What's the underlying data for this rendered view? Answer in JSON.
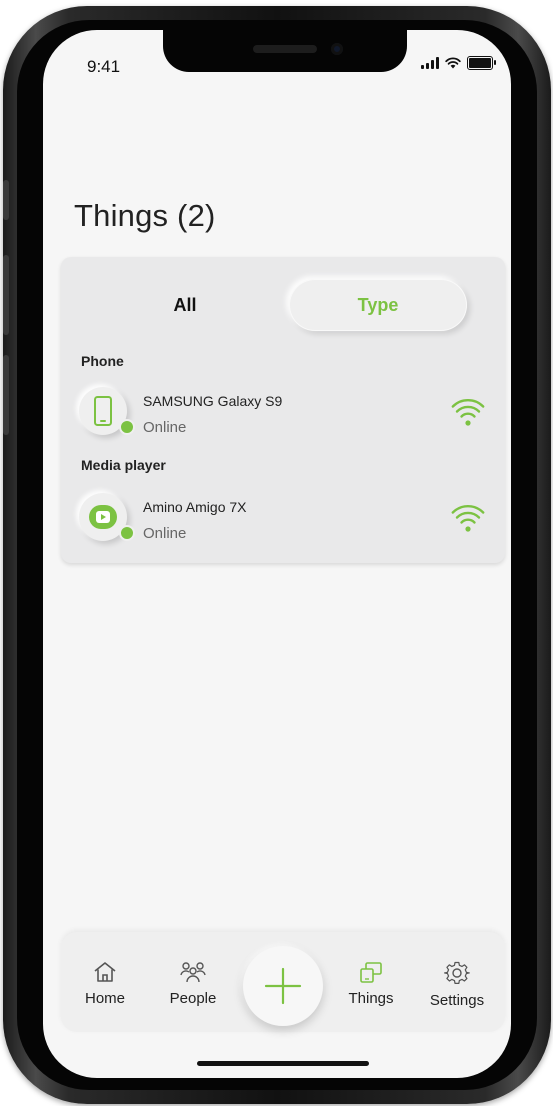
{
  "status_bar": {
    "time": "9:41"
  },
  "page": {
    "title": "Things (2)"
  },
  "tabs": [
    {
      "label": "All",
      "selected": false
    },
    {
      "label": "Type",
      "selected": true
    }
  ],
  "sections": [
    {
      "label": "Phone",
      "device": {
        "name": "SAMSUNG Galaxy S9",
        "status": "Online",
        "icon": "smartphone-icon"
      }
    },
    {
      "label": "Media player",
      "device": {
        "name": "Amino Amigo 7X",
        "status": "Online",
        "icon": "play-icon"
      }
    }
  ],
  "nav": {
    "items": [
      {
        "label": "Home",
        "icon": "home-icon"
      },
      {
        "label": "People",
        "icon": "people-icon"
      },
      {
        "label": "Things",
        "icon": "devices-icon",
        "active": true
      },
      {
        "label": "Settings",
        "icon": "gear-icon"
      }
    ],
    "fab_icon": "plus-icon"
  },
  "colors": {
    "accent": "#7cc242",
    "text": "#222222",
    "background": "#f6f6f6",
    "card": "#e9e9ea"
  }
}
